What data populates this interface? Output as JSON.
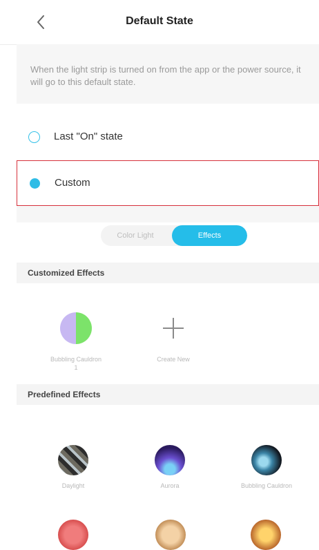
{
  "header": {
    "title": "Default State",
    "back_icon": "chevron-left-icon"
  },
  "description": "When the light strip is turned on from the app or the power source, it will go to this default state.",
  "options": [
    {
      "label": "Last \"On\" state",
      "selected": false
    },
    {
      "label": "Custom",
      "selected": true
    }
  ],
  "segmented": {
    "left": "Color Light",
    "right": "Effects",
    "active": "Effects"
  },
  "customized": {
    "title": "Customized Effects",
    "items": [
      {
        "label": "Bubbling Cauldron 1",
        "icon": "half-color-circle-icon"
      },
      {
        "label": "Create New",
        "icon": "plus-icon"
      }
    ]
  },
  "predefined": {
    "title": "Predefined Effects",
    "items": [
      {
        "label": "Daylight",
        "icon": "daylight-icon"
      },
      {
        "label": "Aurora",
        "icon": "aurora-icon"
      },
      {
        "label": "Bubbling Cauldron",
        "icon": "bubbling-cauldron-icon"
      }
    ]
  },
  "colors": {
    "accent": "#25BDE9",
    "selection_border": "#D62F3A"
  }
}
